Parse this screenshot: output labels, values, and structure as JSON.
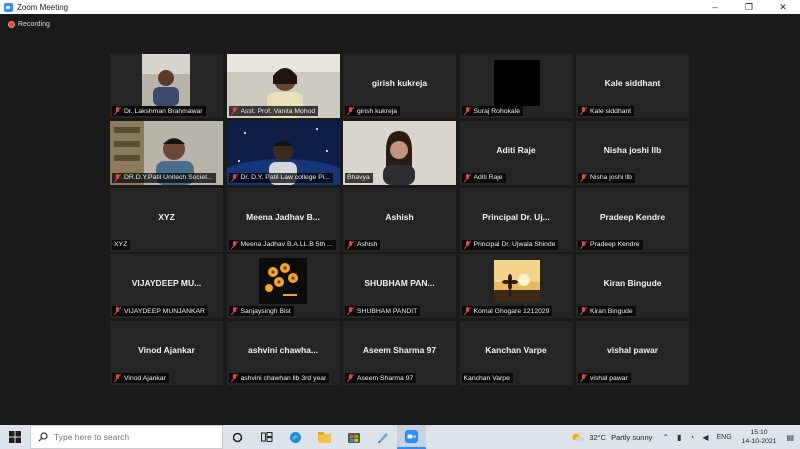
{
  "window": {
    "title": "Zoom Meeting",
    "minimize": "–",
    "maximize": "❐",
    "close": "✕"
  },
  "recording": {
    "label": "Recording",
    "color": "#e8453c"
  },
  "tiles": [
    {
      "name": "Dr. Lakshman Brahmawar",
      "center": "",
      "video": "person-dark",
      "muted": true,
      "active": false
    },
    {
      "name": "Asst. Prof. Vanita Mohod",
      "center": "",
      "video": "person-light",
      "muted": true,
      "active": false
    },
    {
      "name": "girish kukreja",
      "center": "girish kukreja",
      "video": "",
      "muted": true,
      "active": false
    },
    {
      "name": "Suraj Rohokale",
      "center": "",
      "video": "black-square",
      "muted": true,
      "active": false
    },
    {
      "name": "Kale siddhant",
      "center": "Kale siddhant",
      "video": "",
      "muted": true,
      "active": false
    },
    {
      "name": "DR.D.Y.Patil Unitech Societ...",
      "center": "",
      "video": "person-room",
      "muted": true,
      "active": true
    },
    {
      "name": "Dr. D.Y. Patil Law college Pi...",
      "center": "",
      "video": "person-space",
      "muted": true,
      "active": false
    },
    {
      "name": "Bhavya",
      "center": "",
      "video": "person-wall",
      "muted": false,
      "active": false
    },
    {
      "name": "Aditi Raje",
      "center": "Aditi Raje",
      "video": "",
      "muted": true,
      "active": false
    },
    {
      "name": "Nisha joshi llb",
      "center": "Nisha joshi llb",
      "video": "",
      "muted": true,
      "active": false
    },
    {
      "name": "XYZ",
      "center": "XYZ",
      "video": "",
      "muted": false,
      "active": false
    },
    {
      "name": "Meena Jadhav B.A.LL.B 5th ...",
      "center": "Meena Jadhav B...",
      "video": "",
      "muted": true,
      "active": false
    },
    {
      "name": "Ashish",
      "center": "Ashish",
      "video": "",
      "muted": true,
      "active": false
    },
    {
      "name": "Principal Dr. Ujwala Shinde",
      "center": "Principal Dr. Uj...",
      "video": "",
      "muted": true,
      "active": false
    },
    {
      "name": "Pradeep Kendre",
      "center": "Pradeep Kendre",
      "video": "",
      "muted": true,
      "active": false
    },
    {
      "name": "VIJAYDEEP MUNJANKAR",
      "center": "VIJAYDEEP MU...",
      "video": "",
      "muted": true,
      "active": false
    },
    {
      "name": "Sanjaysingh Bist",
      "center": "",
      "video": "flowers",
      "muted": true,
      "active": false
    },
    {
      "name": "SHUBHAM PANDIT",
      "center": "SHUBHAM PAN...",
      "video": "",
      "muted": true,
      "active": false
    },
    {
      "name": "Komal Ghogare 1212029",
      "center": "",
      "video": "sunset-flower",
      "muted": true,
      "active": false
    },
    {
      "name": "Kiran Bingude",
      "center": "Kiran Bingude",
      "video": "",
      "muted": true,
      "active": false
    },
    {
      "name": "Vinod Ajankar",
      "center": "Vinod Ajankar",
      "video": "",
      "muted": true,
      "active": false
    },
    {
      "name": "ashvini chawhan llb 3rd year",
      "center": "ashvini  chawha...",
      "video": "",
      "muted": true,
      "active": false
    },
    {
      "name": "Aseem Sharma 97",
      "center": "Aseem Sharma 97",
      "video": "",
      "muted": true,
      "active": false
    },
    {
      "name": "Kanchan Varpe",
      "center": "Kanchan Varpe",
      "video": "",
      "muted": false,
      "active": false
    },
    {
      "name": "vishal pawar",
      "center": "vishal pawar",
      "video": "",
      "muted": true,
      "active": false
    }
  ],
  "taskbar": {
    "search_placeholder": "Type here to search",
    "weather_temp": "32°C",
    "weather_desc": "Partly sunny",
    "language": "ENG",
    "time": "15:10",
    "date": "14-10-2021"
  }
}
